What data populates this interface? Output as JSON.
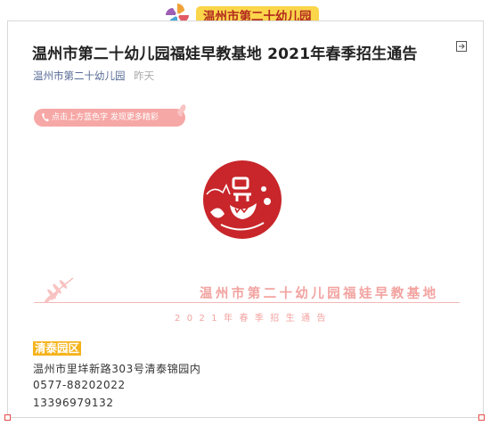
{
  "header": {
    "badge_text": "温州市第二十幼儿园"
  },
  "article": {
    "title": "温州市第二十幼儿园福娃早教基地 2021年春季招生通告",
    "account": "温州市第二十幼儿园",
    "time": "昨天"
  },
  "prompt_pill": {
    "text": "点击上方蓝色字 发现更多精彩"
  },
  "banner": {
    "title": "温州市第二十幼儿园福娃早教基地",
    "subtitle": "2021年春季招生通告"
  },
  "campus": {
    "name": "清泰园区",
    "address": "温州市里垟新路303号清泰锦园内",
    "phone": "0577-88202022",
    "mobile": "13396979132"
  },
  "colors": {
    "accent_pink": "#f2a3a0",
    "badge_yellow": "#fbd54a",
    "logo_red": "#c8262a",
    "campus_orange": "#f5b31b"
  },
  "icons": [
    "pinwheel-icon",
    "exit-icon",
    "phone-icon",
    "leaves-icon",
    "school-logo",
    "fern-icon"
  ]
}
